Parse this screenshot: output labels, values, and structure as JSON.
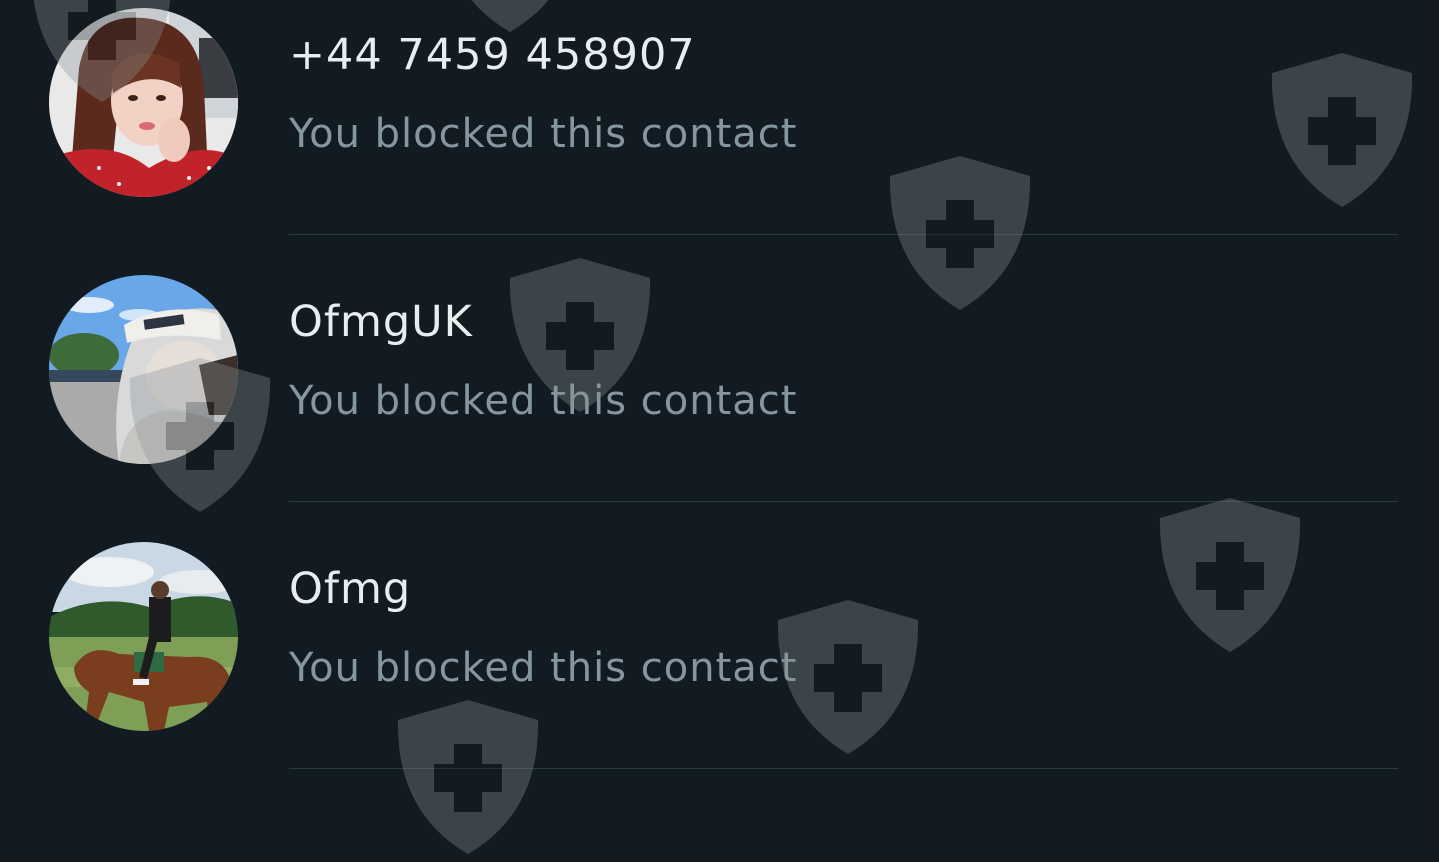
{
  "contacts": [
    {
      "name": "+44 7459 458907",
      "status": "You blocked this contact",
      "avatar": "woman-red-dress-photo"
    },
    {
      "name": "OfmgUK",
      "status": "You blocked this contact",
      "avatar": "man-white-cap-mask-photo"
    },
    {
      "name": "Ofmg",
      "status": "You blocked this contact",
      "avatar": "man-riding-horse-photo"
    }
  ],
  "colors": {
    "background": "#111b21",
    "name_text": "#e9edef",
    "status_text": "#8696a0",
    "divider": "#2a3942",
    "watermark": "#8a9398"
  },
  "watermark_icon": "shield-plus-icon"
}
